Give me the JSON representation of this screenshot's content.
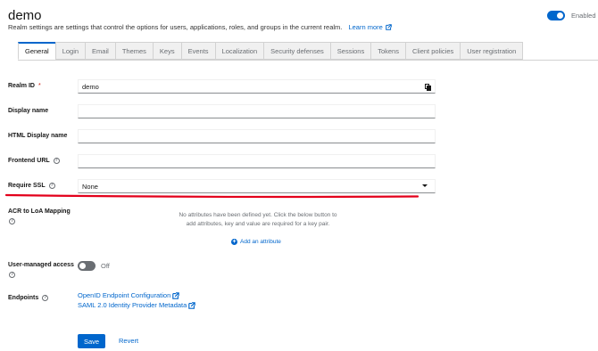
{
  "header": {
    "title": "demo",
    "description": "Realm settings are settings that control the options for users, applications, roles, and groups in the current realm.",
    "learn_more": "Learn more",
    "enabled_label": "Enabled"
  },
  "tabs": [
    {
      "label": "General",
      "active": true
    },
    {
      "label": "Login"
    },
    {
      "label": "Email"
    },
    {
      "label": "Themes"
    },
    {
      "label": "Keys"
    },
    {
      "label": "Events"
    },
    {
      "label": "Localization"
    },
    {
      "label": "Security defenses"
    },
    {
      "label": "Sessions"
    },
    {
      "label": "Tokens"
    },
    {
      "label": "Client policies"
    },
    {
      "label": "User registration"
    }
  ],
  "form": {
    "realm_id": {
      "label": "Realm ID",
      "required_mark": "*",
      "value": "demo"
    },
    "display_name": {
      "label": "Display name",
      "value": ""
    },
    "html_display_name": {
      "label": "HTML Display name",
      "value": ""
    },
    "frontend_url": {
      "label": "Frontend URL",
      "value": ""
    },
    "require_ssl": {
      "label": "Require SSL",
      "value": "None"
    },
    "acr_mapping": {
      "label": "ACR to LoA Mapping",
      "empty_text": "No attributes have been defined yet. Click the below button to add attributes, key and value are required for a key pair.",
      "add_label": "Add an attribute"
    },
    "user_managed_access": {
      "label": "User-managed access",
      "state_label": "Off"
    },
    "endpoints": {
      "label": "Endpoints",
      "links": [
        "OpenID Endpoint Configuration",
        "SAML 2.0 Identity Provider Metadata"
      ]
    }
  },
  "actions": {
    "save": "Save",
    "revert": "Revert"
  },
  "colors": {
    "accent": "#0066cc",
    "annotation": "#e3001b"
  }
}
